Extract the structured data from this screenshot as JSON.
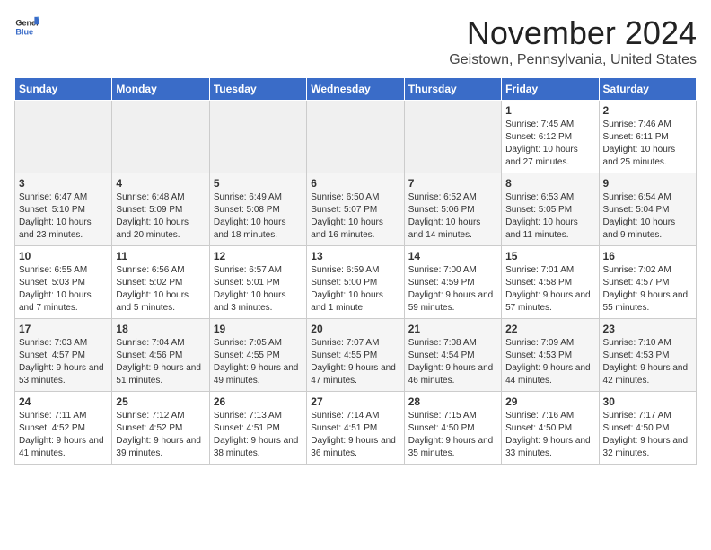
{
  "header": {
    "logo_general": "General",
    "logo_blue": "Blue",
    "month": "November 2024",
    "location": "Geistown, Pennsylvania, United States"
  },
  "days_of_week": [
    "Sunday",
    "Monday",
    "Tuesday",
    "Wednesday",
    "Thursday",
    "Friday",
    "Saturday"
  ],
  "weeks": [
    [
      {
        "day": "",
        "empty": true
      },
      {
        "day": "",
        "empty": true
      },
      {
        "day": "",
        "empty": true
      },
      {
        "day": "",
        "empty": true
      },
      {
        "day": "",
        "empty": true
      },
      {
        "day": "1",
        "sunrise": "7:45 AM",
        "sunset": "6:12 PM",
        "daylight": "10 hours and 27 minutes."
      },
      {
        "day": "2",
        "sunrise": "7:46 AM",
        "sunset": "6:11 PM",
        "daylight": "10 hours and 25 minutes."
      }
    ],
    [
      {
        "day": "3",
        "sunrise": "6:47 AM",
        "sunset": "5:10 PM",
        "daylight": "10 hours and 23 minutes."
      },
      {
        "day": "4",
        "sunrise": "6:48 AM",
        "sunset": "5:09 PM",
        "daylight": "10 hours and 20 minutes."
      },
      {
        "day": "5",
        "sunrise": "6:49 AM",
        "sunset": "5:08 PM",
        "daylight": "10 hours and 18 minutes."
      },
      {
        "day": "6",
        "sunrise": "6:50 AM",
        "sunset": "5:07 PM",
        "daylight": "10 hours and 16 minutes."
      },
      {
        "day": "7",
        "sunrise": "6:52 AM",
        "sunset": "5:06 PM",
        "daylight": "10 hours and 14 minutes."
      },
      {
        "day": "8",
        "sunrise": "6:53 AM",
        "sunset": "5:05 PM",
        "daylight": "10 hours and 11 minutes."
      },
      {
        "day": "9",
        "sunrise": "6:54 AM",
        "sunset": "5:04 PM",
        "daylight": "10 hours and 9 minutes."
      }
    ],
    [
      {
        "day": "10",
        "sunrise": "6:55 AM",
        "sunset": "5:03 PM",
        "daylight": "10 hours and 7 minutes."
      },
      {
        "day": "11",
        "sunrise": "6:56 AM",
        "sunset": "5:02 PM",
        "daylight": "10 hours and 5 minutes."
      },
      {
        "day": "12",
        "sunrise": "6:57 AM",
        "sunset": "5:01 PM",
        "daylight": "10 hours and 3 minutes."
      },
      {
        "day": "13",
        "sunrise": "6:59 AM",
        "sunset": "5:00 PM",
        "daylight": "10 hours and 1 minute."
      },
      {
        "day": "14",
        "sunrise": "7:00 AM",
        "sunset": "4:59 PM",
        "daylight": "9 hours and 59 minutes."
      },
      {
        "day": "15",
        "sunrise": "7:01 AM",
        "sunset": "4:58 PM",
        "daylight": "9 hours and 57 minutes."
      },
      {
        "day": "16",
        "sunrise": "7:02 AM",
        "sunset": "4:57 PM",
        "daylight": "9 hours and 55 minutes."
      }
    ],
    [
      {
        "day": "17",
        "sunrise": "7:03 AM",
        "sunset": "4:57 PM",
        "daylight": "9 hours and 53 minutes."
      },
      {
        "day": "18",
        "sunrise": "7:04 AM",
        "sunset": "4:56 PM",
        "daylight": "9 hours and 51 minutes."
      },
      {
        "day": "19",
        "sunrise": "7:05 AM",
        "sunset": "4:55 PM",
        "daylight": "9 hours and 49 minutes."
      },
      {
        "day": "20",
        "sunrise": "7:07 AM",
        "sunset": "4:55 PM",
        "daylight": "9 hours and 47 minutes."
      },
      {
        "day": "21",
        "sunrise": "7:08 AM",
        "sunset": "4:54 PM",
        "daylight": "9 hours and 46 minutes."
      },
      {
        "day": "22",
        "sunrise": "7:09 AM",
        "sunset": "4:53 PM",
        "daylight": "9 hours and 44 minutes."
      },
      {
        "day": "23",
        "sunrise": "7:10 AM",
        "sunset": "4:53 PM",
        "daylight": "9 hours and 42 minutes."
      }
    ],
    [
      {
        "day": "24",
        "sunrise": "7:11 AM",
        "sunset": "4:52 PM",
        "daylight": "9 hours and 41 minutes."
      },
      {
        "day": "25",
        "sunrise": "7:12 AM",
        "sunset": "4:52 PM",
        "daylight": "9 hours and 39 minutes."
      },
      {
        "day": "26",
        "sunrise": "7:13 AM",
        "sunset": "4:51 PM",
        "daylight": "9 hours and 38 minutes."
      },
      {
        "day": "27",
        "sunrise": "7:14 AM",
        "sunset": "4:51 PM",
        "daylight": "9 hours and 36 minutes."
      },
      {
        "day": "28",
        "sunrise": "7:15 AM",
        "sunset": "4:50 PM",
        "daylight": "9 hours and 35 minutes."
      },
      {
        "day": "29",
        "sunrise": "7:16 AM",
        "sunset": "4:50 PM",
        "daylight": "9 hours and 33 minutes."
      },
      {
        "day": "30",
        "sunrise": "7:17 AM",
        "sunset": "4:50 PM",
        "daylight": "9 hours and 32 minutes."
      }
    ]
  ]
}
